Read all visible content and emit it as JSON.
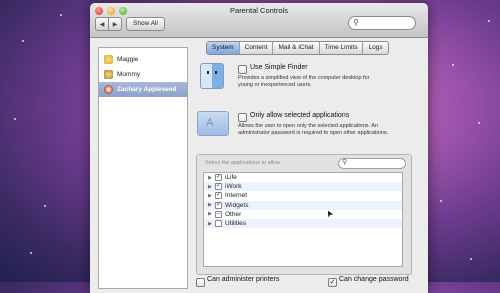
{
  "window": {
    "title": "Parental Controls"
  },
  "toolbar": {
    "back_icon": "◀",
    "forward_icon": "▶",
    "show_all_label": "Show All"
  },
  "search": {
    "icon": "⚲"
  },
  "sidebar": {
    "users": [
      {
        "label": "Maggie"
      },
      {
        "label": "Mommy"
      },
      {
        "label": "Zachary Appleseed"
      }
    ]
  },
  "tabs": [
    {
      "label": "System"
    },
    {
      "label": "Content"
    },
    {
      "label": "Mail & iChat"
    },
    {
      "label": "Time Limits"
    },
    {
      "label": "Logs"
    }
  ],
  "system": {
    "simple_finder": {
      "label": "Use Simple Finder",
      "desc1": "Provides a simplified view of the computer desktop for",
      "desc2": "young or inexperienced users."
    },
    "only_allow": {
      "label": "Only allow selected applications",
      "desc1": "Allows the user to open only the selected applications. An",
      "desc2": "administrator password is required to open other applications."
    },
    "apps": {
      "prompt": "Select the applications to allow",
      "search_icon": "⚲",
      "rows": [
        {
          "label": "iLife",
          "mark": "✓"
        },
        {
          "label": "iWork",
          "mark": "✓"
        },
        {
          "label": "Internet",
          "mark": "✓"
        },
        {
          "label": "Widgets",
          "mark": "✓"
        },
        {
          "label": "Other",
          "mark": "–"
        },
        {
          "label": "Utilities",
          "mark": ""
        }
      ],
      "disclosure": "▶"
    },
    "bottom": {
      "administer_printers": "Can administer printers",
      "change_password": "Can change password",
      "check": "✓"
    }
  },
  "cursor": "➤"
}
